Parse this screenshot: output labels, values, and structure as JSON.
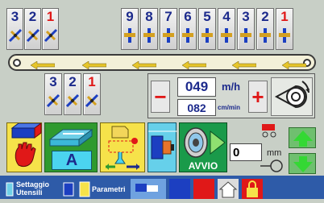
{
  "top_stations": {
    "left": [
      {
        "number": "3",
        "color": "#1c2a8c"
      },
      {
        "number": "2",
        "color": "#1c2a8c"
      },
      {
        "number": "1",
        "color": "#e01818"
      }
    ],
    "right": [
      {
        "number": "9",
        "color": "#1c2a8c"
      },
      {
        "number": "8",
        "color": "#1c2a8c"
      },
      {
        "number": "7",
        "color": "#1c2a8c"
      },
      {
        "number": "6",
        "color": "#1c2a8c"
      },
      {
        "number": "5",
        "color": "#1c2a8c"
      },
      {
        "number": "4",
        "color": "#1c2a8c"
      },
      {
        "number": "3",
        "color": "#1c2a8c"
      },
      {
        "number": "2",
        "color": "#1c2a8c"
      },
      {
        "number": "1",
        "color": "#e01818"
      }
    ]
  },
  "bottom_stations": [
    {
      "number": "3",
      "color": "#1c2a8c"
    },
    {
      "number": "2",
      "color": "#1c2a8c"
    },
    {
      "number": "1",
      "color": "#e01818"
    }
  ],
  "speed": {
    "value": "049",
    "unit": "m/h",
    "secondary_value": "082",
    "secondary_unit": "cm/min",
    "minus_label": "−",
    "plus_label": "+"
  },
  "controls": {
    "mode_label": "A",
    "start_label": "AVVIO",
    "position_value": "0",
    "position_unit": "mm"
  },
  "bottom_tabs": {
    "setup_label_1": "Settaggio",
    "setup_label_2": "Utensili",
    "params_label": "Parametri"
  },
  "colors": {
    "accent_red": "#e01818",
    "accent_green": "#2f9a2f",
    "accent_blue": "#1c2a8c",
    "motor_green": "#1a9a4a"
  }
}
